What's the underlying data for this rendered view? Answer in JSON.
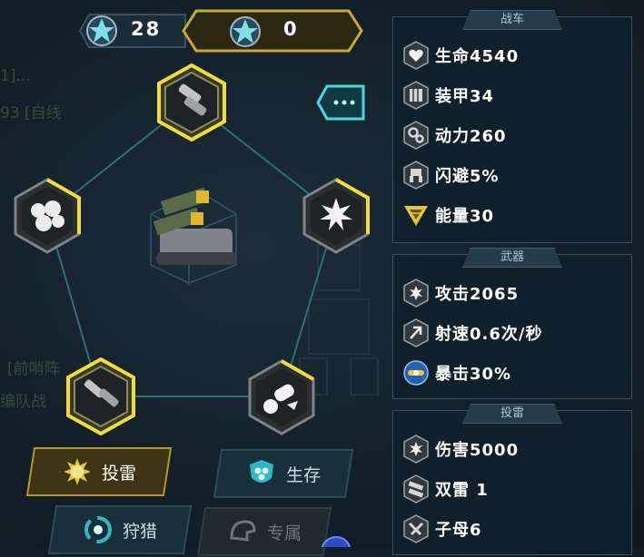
{
  "currency": {
    "gear_stars": "28",
    "gold_stars": "0"
  },
  "background_text": {
    "line1": "1]...",
    "line2": "93 [自线",
    "line3": "[前哨阵",
    "line4": "编队战"
  },
  "panels": {
    "vehicle": {
      "title": "战车",
      "stats": [
        {
          "icon": "heart-icon",
          "text": "生命4540"
        },
        {
          "icon": "armor-plate-icon",
          "text": "装甲34"
        },
        {
          "icon": "gears-icon",
          "text": "动力260"
        },
        {
          "icon": "dodge-mech-icon",
          "text": "闪避5%"
        },
        {
          "icon": "energy-chevron-icon",
          "text": "能量30"
        }
      ]
    },
    "weapon": {
      "title": "武器",
      "stats": [
        {
          "icon": "attack-burst-icon",
          "text": "攻击2065"
        },
        {
          "icon": "fire-rate-icon",
          "text": "射速0.6次/秒"
        },
        {
          "icon": "critical-orb-icon",
          "text": "暴击30%"
        }
      ]
    },
    "mine": {
      "title": "投雷",
      "stats": [
        {
          "icon": "damage-burst-icon",
          "text": "伤害5000"
        },
        {
          "icon": "double-mine-icon",
          "text": "双雷 1"
        },
        {
          "icon": "cluster-mine-icon",
          "text": "子母6"
        }
      ]
    }
  },
  "tabs": {
    "mine": "投雷",
    "survive": "生存",
    "hunt": "狩猎",
    "exclusive": "专属"
  },
  "colors": {
    "gold": "#e8c53a",
    "teal": "#4fd6e0",
    "panel_border": "#3a5260"
  }
}
